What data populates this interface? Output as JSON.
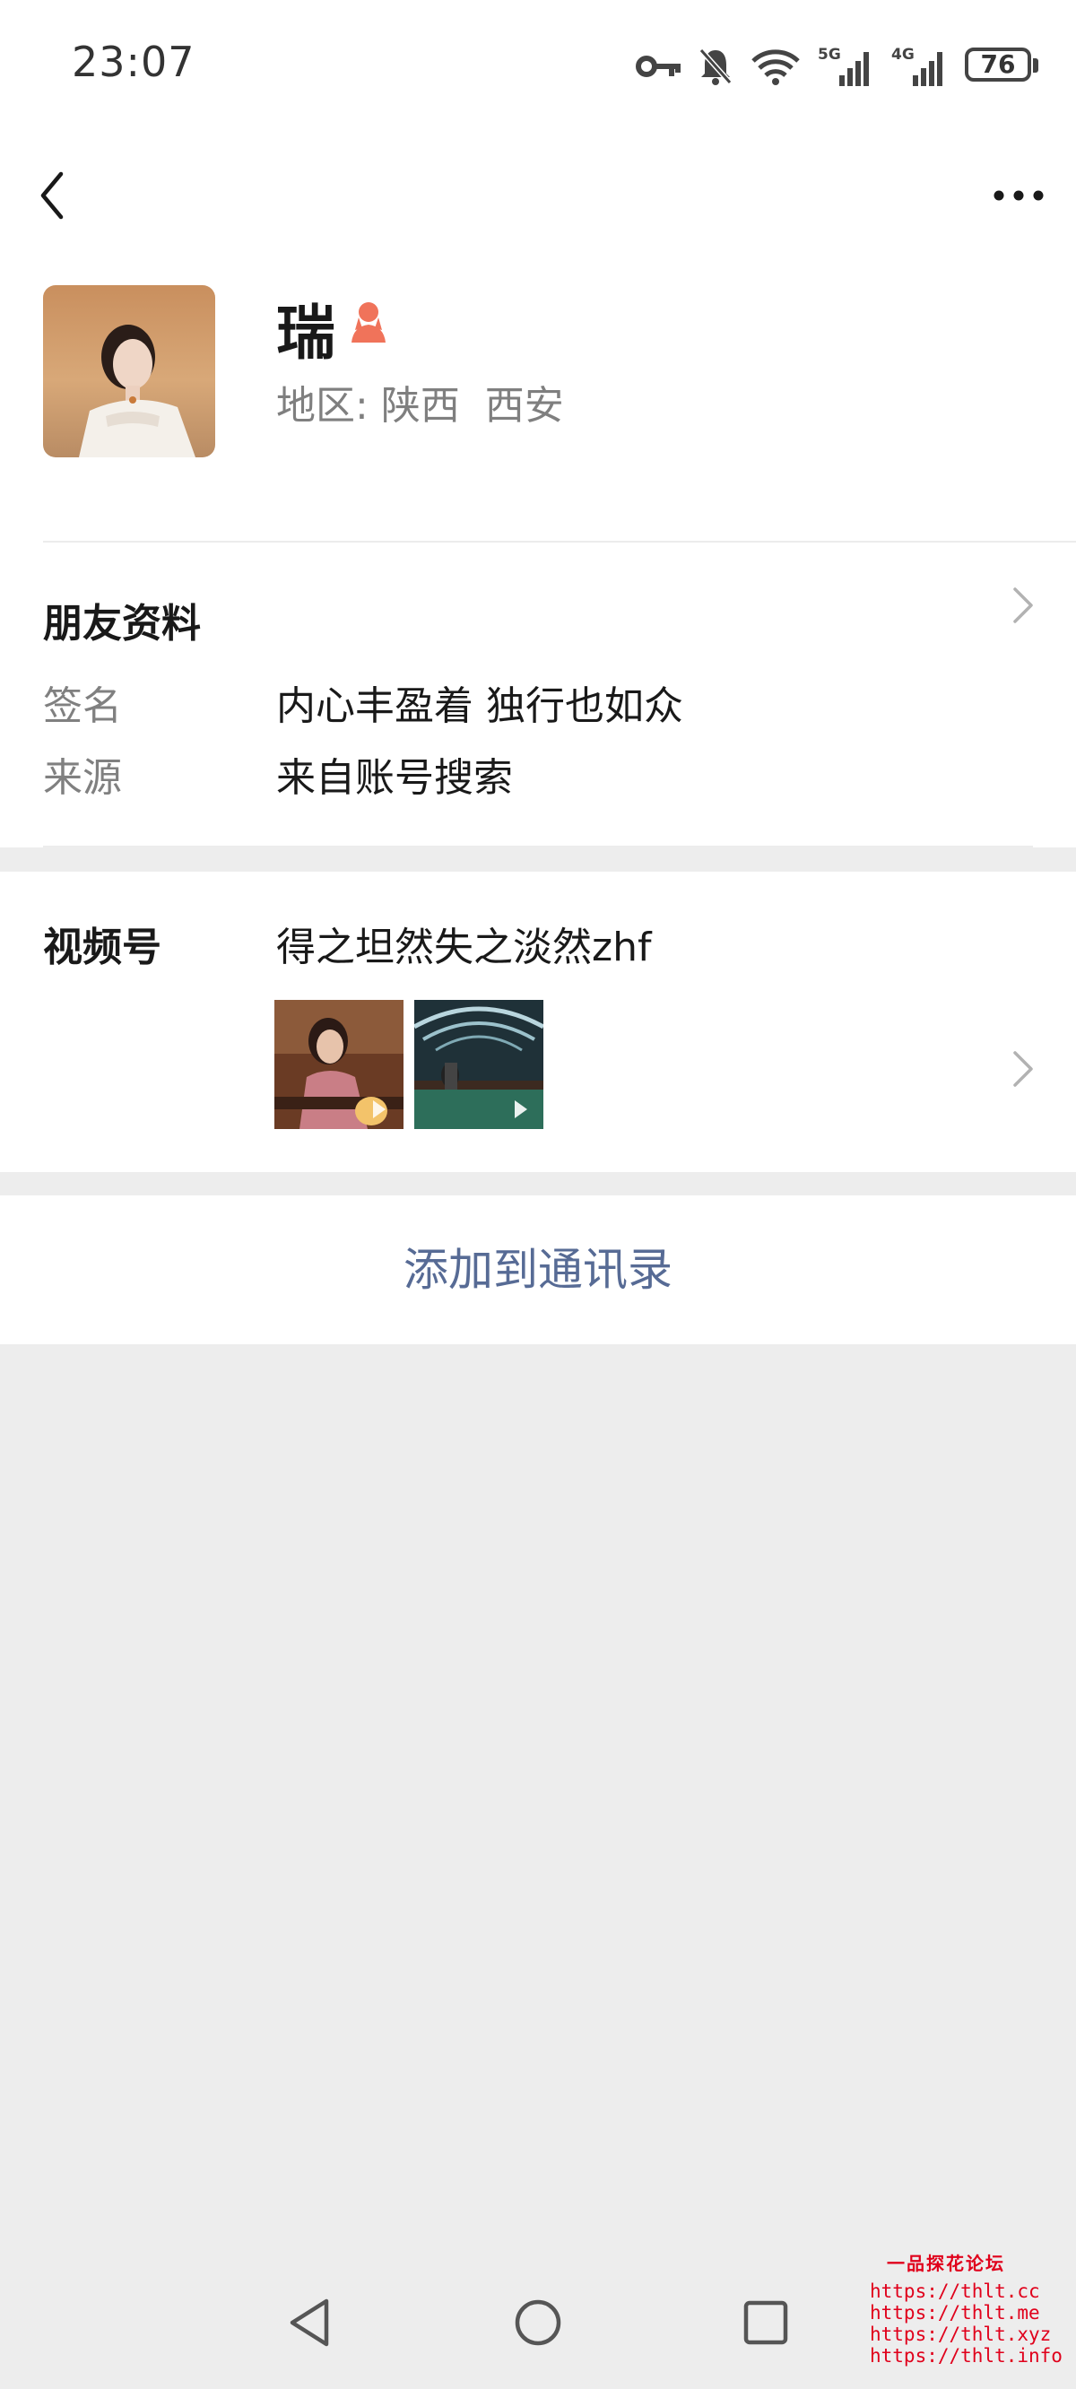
{
  "status_bar": {
    "time": "23:07",
    "battery": "76",
    "network_labels": [
      "5G",
      "4G"
    ]
  },
  "profile": {
    "name": "瑞",
    "gender_icon": "female-icon",
    "region_label": "地区:",
    "region_value": "陕西  西安"
  },
  "moments": {
    "title": "朋友资料",
    "signature_label": "签名",
    "signature_value": "内心丰盈着 独行也如众",
    "source_label": "来源",
    "source_value": "来自账号搜索"
  },
  "channels": {
    "title": "视频号",
    "account_name": "得之坦然失之淡然zhf"
  },
  "actions": {
    "add_contact": "添加到通讯录"
  },
  "watermark": {
    "title": "一品探花论坛",
    "lines": [
      "https://thlt.cc",
      "https://thlt.me",
      "https://thlt.xyz",
      "https://thlt.info"
    ]
  },
  "colors": {
    "link_blue": "#576b95",
    "female_icon": "#f0735a",
    "background": "#ededed",
    "watermark_red": "#e0001b"
  }
}
